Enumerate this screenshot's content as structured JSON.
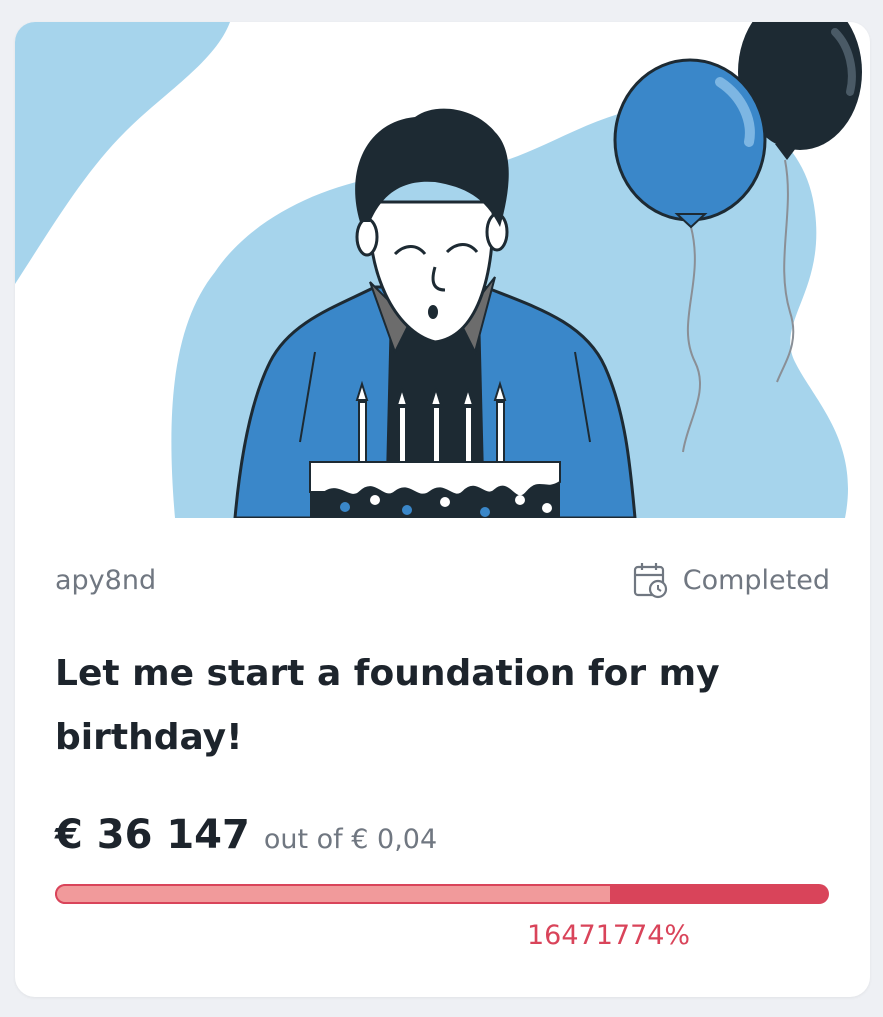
{
  "campaign": {
    "author": "apy8nd",
    "status": "Completed",
    "title": "Let me start a foundation for my birthday!",
    "raised": "€ 36 147",
    "goal_text": "out of € 0,04",
    "percent_text": "16471774%"
  },
  "icons": {
    "status": "calendar-clock-icon"
  },
  "colors": {
    "accent": "#d9445a",
    "progress_light": "#f19a9b",
    "title_text": "#1d242c",
    "muted_text": "#707781",
    "illustration_blue": "#3a87c9",
    "illustration_light_blue": "#a6d4ec"
  }
}
